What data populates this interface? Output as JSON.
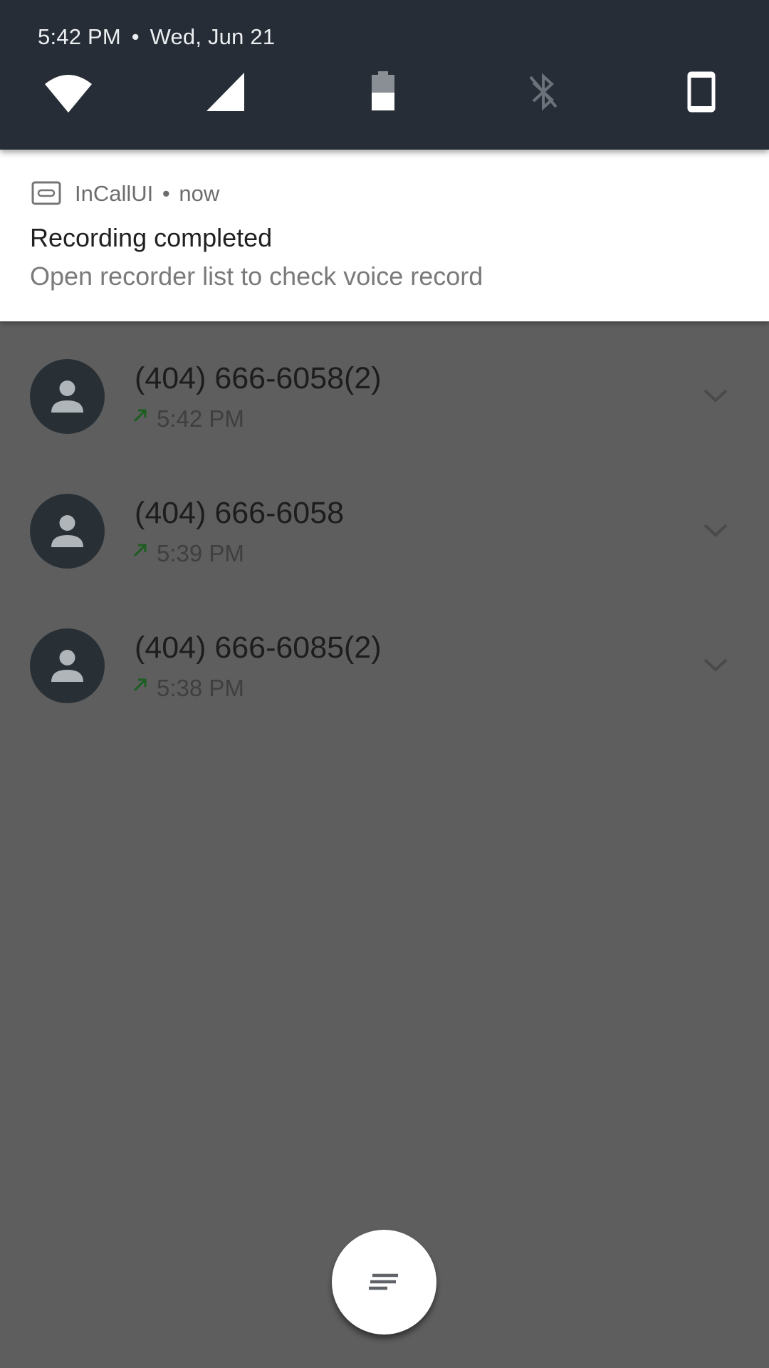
{
  "status": {
    "time": "5:42 PM",
    "separator": "•",
    "date": "Wed, Jun 21"
  },
  "quick_settings": {
    "tiles": [
      {
        "icon": "wifi-icon",
        "active": true
      },
      {
        "icon": "cell-signal-icon",
        "active": true
      },
      {
        "icon": "battery-icon",
        "level": 0.45
      },
      {
        "icon": "bluetooth-off-icon",
        "active": false
      },
      {
        "icon": "phone-portrait-icon",
        "active": true
      }
    ]
  },
  "notification": {
    "app_icon": "voicemail-icon",
    "app_name": "InCallUI",
    "dot": "•",
    "when": "now",
    "title": "Recording completed",
    "text": "Open recorder list to check voice record"
  },
  "calls": [
    {
      "number": "(404) 666-6058(2)",
      "time": "5:42 PM",
      "direction_icon": "outgoing-call-icon"
    },
    {
      "number": "(404) 666-6058",
      "time": "5:39 PM",
      "direction_icon": "outgoing-call-icon"
    },
    {
      "number": "(404) 666-6085(2)",
      "time": "5:38 PM",
      "direction_icon": "outgoing-call-icon"
    }
  ],
  "fab": {
    "icon": "notes-list-icon"
  },
  "colors": {
    "header_bg": "#272d36",
    "scrim_bg": "#5e5e5e",
    "avatar_bg": "#283036",
    "outgoing_arrow": "#1b5e20"
  }
}
